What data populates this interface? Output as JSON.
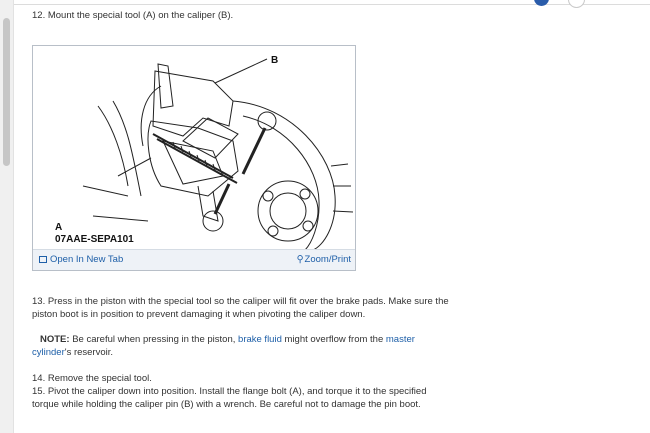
{
  "step12": "12. Mount the special tool (A) on the caliper (B).",
  "figure": {
    "callout_b": "B",
    "callout_a": "A",
    "tool_code": "07AAE-SEPA101",
    "open_tab": "Open In New Tab",
    "zoom_print": "Zoom/Print"
  },
  "step13_line1": "13. Press in the piston with the special tool so the caliper will fit over the brake pads. Make sure the",
  "step13_line2": "piston boot is in position to prevent damaging it when pivoting the caliper down.",
  "note": {
    "label": "NOTE:",
    "text1": " Be careful when pressing in the piston, ",
    "link1": "brake fluid",
    "text2": " might overflow from the ",
    "link2a": "master",
    "link2b": "cylinder",
    "text3": "'s reservoir."
  },
  "step14": "14. Remove the special tool.",
  "step15_line1": "15. Pivot the caliper down into position. Install the flange bolt (A), and torque it to the specified",
  "step15_line2": "torque while holding the caliper pin (B) with a wrench. Be careful not to damage the pin boot.",
  "colors": {
    "link": "#1e5fa8",
    "text": "#333333",
    "accent": "#2a5caa"
  }
}
